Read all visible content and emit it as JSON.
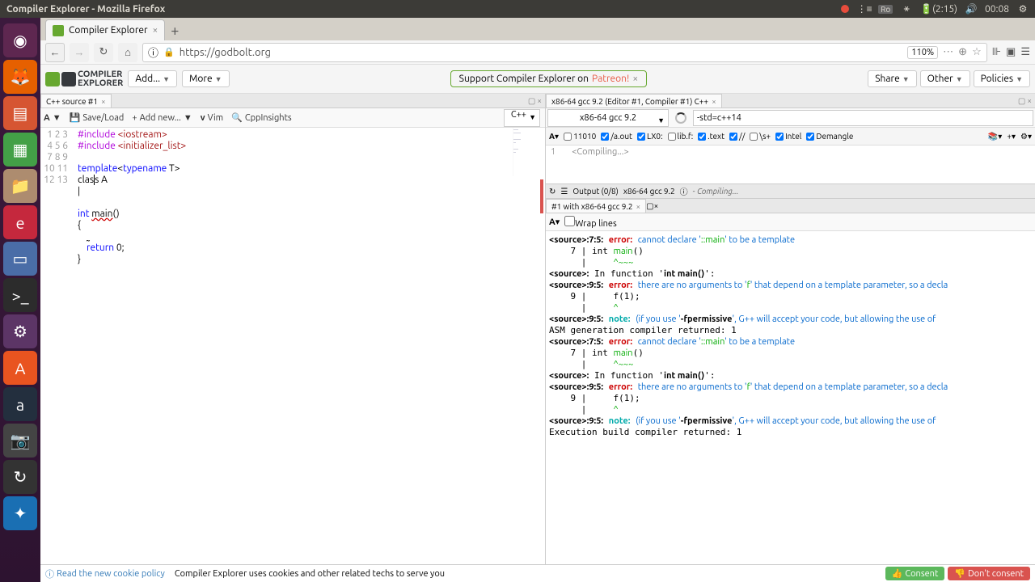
{
  "os": {
    "window_title": "Compiler Explorer - Mozilla Firefox",
    "keyboard": "Ro",
    "battery": "(2:15)",
    "clock": "00:08"
  },
  "browser": {
    "tab_title": "Compiler Explorer",
    "url": "https://godbolt.org",
    "zoom": "110%"
  },
  "ce": {
    "logo_top": "COMPILER",
    "logo_bottom": "EXPLORER",
    "add": "Add...",
    "more": "More",
    "support_pre": "Support Compiler Explorer on ",
    "support_link": "Patreon!",
    "share": "Share",
    "other": "Other",
    "policies": "Policies"
  },
  "editor": {
    "tab": "C++ source #1",
    "saveload": "Save/Load",
    "addnew": "Add new...",
    "vim": "Vim",
    "cppinsights": "CppInsights",
    "lang": "C++",
    "lines": [
      "1",
      "2",
      "3",
      "4",
      "5",
      "6",
      "7",
      "8",
      "9",
      "10",
      "11",
      "12",
      "13"
    ]
  },
  "compiler": {
    "tab": "x86-64 gcc 9.2 (Editor #1, Compiler #1) C++",
    "selected": "x86-64 gcc 9.2",
    "options": "-std=c++14",
    "asm_opts": {
      "b": "11010",
      "aout": "/a.out",
      "lx0": "LX0:",
      "libf": "lib.f:",
      "text": ".text",
      "sl": "\\s+",
      "intel": "Intel",
      "demangle": "Demangle"
    },
    "compiling": "<Compiling...>",
    "output_label": "Output (0/8)",
    "output_compiler": "x86-64 gcc 9.2",
    "output_status": "- Compiling...",
    "diag_tab": "#1 with x86-64 gcc 9.2",
    "wrap": "Wrap lines"
  },
  "cookie": {
    "policy_link": "Read the new cookie policy",
    "text": "Compiler Explorer uses cookies and other related techs to serve you",
    "consent": "Consent",
    "noconsent": "Don't consent"
  }
}
